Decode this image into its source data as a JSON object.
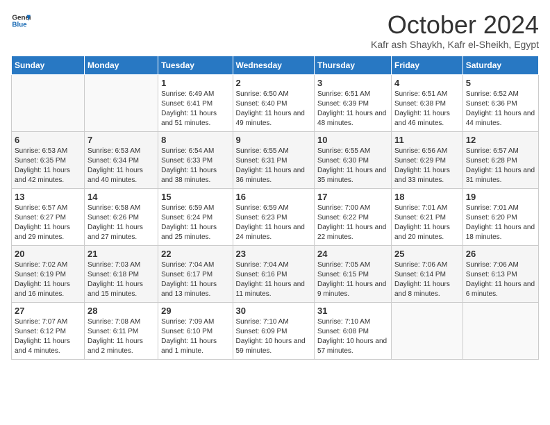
{
  "header": {
    "logo_line1": "General",
    "logo_line2": "Blue",
    "month": "October 2024",
    "location": "Kafr ash Shaykh, Kafr el-Sheikh, Egypt"
  },
  "weekdays": [
    "Sunday",
    "Monday",
    "Tuesday",
    "Wednesday",
    "Thursday",
    "Friday",
    "Saturday"
  ],
  "weeks": [
    [
      {
        "day": "",
        "info": ""
      },
      {
        "day": "",
        "info": ""
      },
      {
        "day": "1",
        "info": "Sunrise: 6:49 AM\nSunset: 6:41 PM\nDaylight: 11 hours and 51 minutes."
      },
      {
        "day": "2",
        "info": "Sunrise: 6:50 AM\nSunset: 6:40 PM\nDaylight: 11 hours and 49 minutes."
      },
      {
        "day": "3",
        "info": "Sunrise: 6:51 AM\nSunset: 6:39 PM\nDaylight: 11 hours and 48 minutes."
      },
      {
        "day": "4",
        "info": "Sunrise: 6:51 AM\nSunset: 6:38 PM\nDaylight: 11 hours and 46 minutes."
      },
      {
        "day": "5",
        "info": "Sunrise: 6:52 AM\nSunset: 6:36 PM\nDaylight: 11 hours and 44 minutes."
      }
    ],
    [
      {
        "day": "6",
        "info": "Sunrise: 6:53 AM\nSunset: 6:35 PM\nDaylight: 11 hours and 42 minutes."
      },
      {
        "day": "7",
        "info": "Sunrise: 6:53 AM\nSunset: 6:34 PM\nDaylight: 11 hours and 40 minutes."
      },
      {
        "day": "8",
        "info": "Sunrise: 6:54 AM\nSunset: 6:33 PM\nDaylight: 11 hours and 38 minutes."
      },
      {
        "day": "9",
        "info": "Sunrise: 6:55 AM\nSunset: 6:31 PM\nDaylight: 11 hours and 36 minutes."
      },
      {
        "day": "10",
        "info": "Sunrise: 6:55 AM\nSunset: 6:30 PM\nDaylight: 11 hours and 35 minutes."
      },
      {
        "day": "11",
        "info": "Sunrise: 6:56 AM\nSunset: 6:29 PM\nDaylight: 11 hours and 33 minutes."
      },
      {
        "day": "12",
        "info": "Sunrise: 6:57 AM\nSunset: 6:28 PM\nDaylight: 11 hours and 31 minutes."
      }
    ],
    [
      {
        "day": "13",
        "info": "Sunrise: 6:57 AM\nSunset: 6:27 PM\nDaylight: 11 hours and 29 minutes."
      },
      {
        "day": "14",
        "info": "Sunrise: 6:58 AM\nSunset: 6:26 PM\nDaylight: 11 hours and 27 minutes."
      },
      {
        "day": "15",
        "info": "Sunrise: 6:59 AM\nSunset: 6:24 PM\nDaylight: 11 hours and 25 minutes."
      },
      {
        "day": "16",
        "info": "Sunrise: 6:59 AM\nSunset: 6:23 PM\nDaylight: 11 hours and 24 minutes."
      },
      {
        "day": "17",
        "info": "Sunrise: 7:00 AM\nSunset: 6:22 PM\nDaylight: 11 hours and 22 minutes."
      },
      {
        "day": "18",
        "info": "Sunrise: 7:01 AM\nSunset: 6:21 PM\nDaylight: 11 hours and 20 minutes."
      },
      {
        "day": "19",
        "info": "Sunrise: 7:01 AM\nSunset: 6:20 PM\nDaylight: 11 hours and 18 minutes."
      }
    ],
    [
      {
        "day": "20",
        "info": "Sunrise: 7:02 AM\nSunset: 6:19 PM\nDaylight: 11 hours and 16 minutes."
      },
      {
        "day": "21",
        "info": "Sunrise: 7:03 AM\nSunset: 6:18 PM\nDaylight: 11 hours and 15 minutes."
      },
      {
        "day": "22",
        "info": "Sunrise: 7:04 AM\nSunset: 6:17 PM\nDaylight: 11 hours and 13 minutes."
      },
      {
        "day": "23",
        "info": "Sunrise: 7:04 AM\nSunset: 6:16 PM\nDaylight: 11 hours and 11 minutes."
      },
      {
        "day": "24",
        "info": "Sunrise: 7:05 AM\nSunset: 6:15 PM\nDaylight: 11 hours and 9 minutes."
      },
      {
        "day": "25",
        "info": "Sunrise: 7:06 AM\nSunset: 6:14 PM\nDaylight: 11 hours and 8 minutes."
      },
      {
        "day": "26",
        "info": "Sunrise: 7:06 AM\nSunset: 6:13 PM\nDaylight: 11 hours and 6 minutes."
      }
    ],
    [
      {
        "day": "27",
        "info": "Sunrise: 7:07 AM\nSunset: 6:12 PM\nDaylight: 11 hours and 4 minutes."
      },
      {
        "day": "28",
        "info": "Sunrise: 7:08 AM\nSunset: 6:11 PM\nDaylight: 11 hours and 2 minutes."
      },
      {
        "day": "29",
        "info": "Sunrise: 7:09 AM\nSunset: 6:10 PM\nDaylight: 11 hours and 1 minute."
      },
      {
        "day": "30",
        "info": "Sunrise: 7:10 AM\nSunset: 6:09 PM\nDaylight: 10 hours and 59 minutes."
      },
      {
        "day": "31",
        "info": "Sunrise: 7:10 AM\nSunset: 6:08 PM\nDaylight: 10 hours and 57 minutes."
      },
      {
        "day": "",
        "info": ""
      },
      {
        "day": "",
        "info": ""
      }
    ]
  ]
}
